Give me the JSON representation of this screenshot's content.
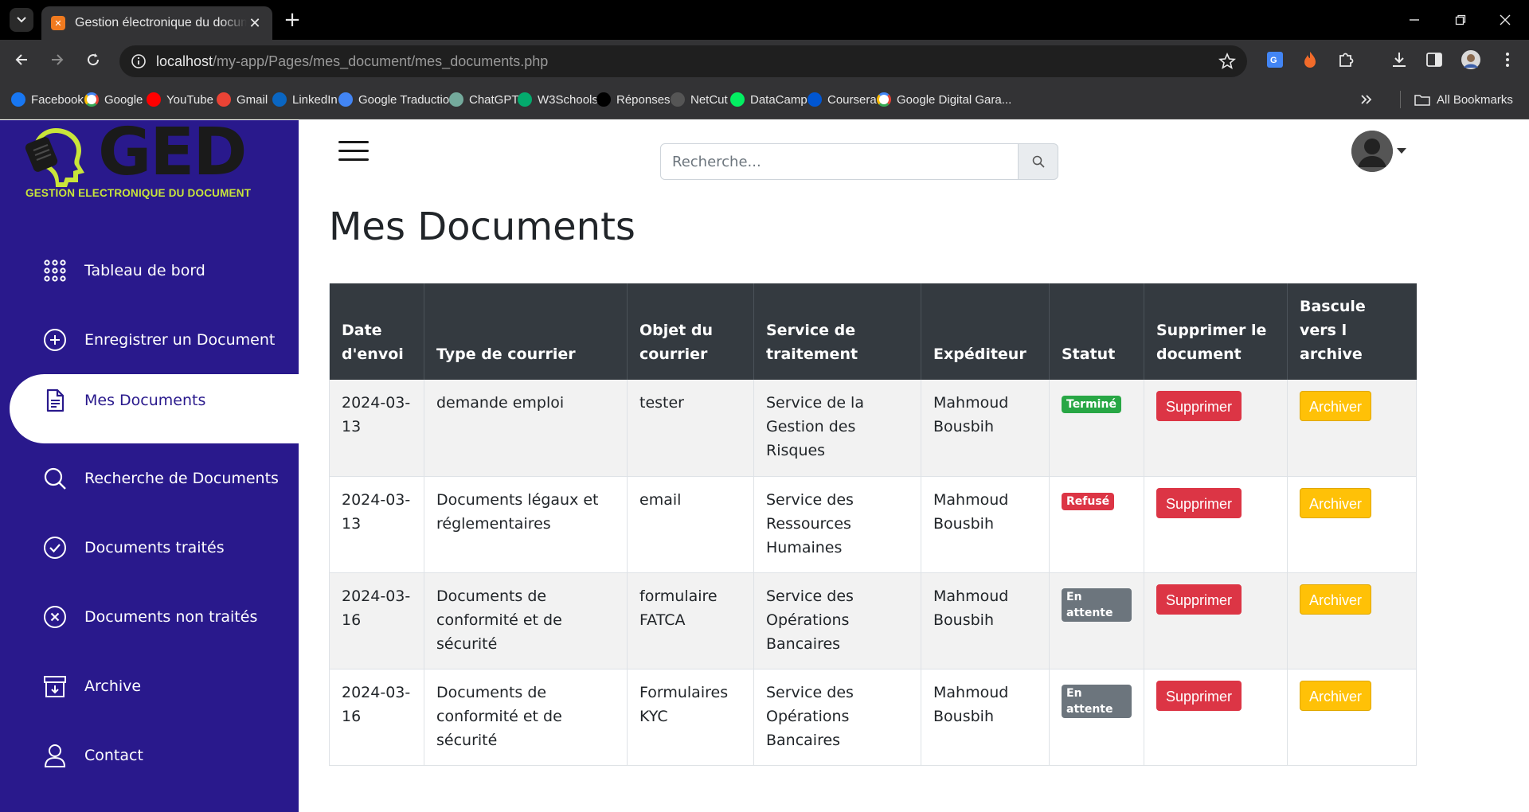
{
  "browser": {
    "tab_title": "Gestion électronique du document",
    "url_host": "localhost",
    "url_path": "/my-app/Pages/mes_document/mes_documents.php",
    "bookmarks": [
      {
        "label": "Facebook",
        "icon": "facebook-icon",
        "color": "#1877f2"
      },
      {
        "label": "Google",
        "icon": "google-icon",
        "color": "#ffffff"
      },
      {
        "label": "YouTube",
        "icon": "youtube-icon",
        "color": "#ff0000"
      },
      {
        "label": "Gmail",
        "icon": "gmail-icon",
        "color": "#ea4335"
      },
      {
        "label": "LinkedIn",
        "icon": "linkedin-icon",
        "color": "#0a66c2"
      },
      {
        "label": "Google Traduction",
        "icon": "google-translate-icon",
        "color": "#4285f4"
      },
      {
        "label": "ChatGPT",
        "icon": "chatgpt-icon",
        "color": "#74aa9c"
      },
      {
        "label": "W3Schools",
        "icon": "w3schools-icon",
        "color": "#04aa6d"
      },
      {
        "label": "Réponses",
        "icon": "x-icon",
        "color": "#000000"
      },
      {
        "label": "NetCut",
        "icon": "netcut-icon",
        "color": "#555555"
      },
      {
        "label": "DataCamp",
        "icon": "datacamp-icon",
        "color": "#03ef62"
      },
      {
        "label": "Coursera",
        "icon": "coursera-icon",
        "color": "#0056d2"
      },
      {
        "label": "Google Digital Gara...",
        "icon": "google-icon",
        "color": "#ffffff"
      }
    ],
    "all_bookmarks_label": "All Bookmarks"
  },
  "sidebar": {
    "logo_text": "GED",
    "logo_subtitle": "GESTION ELECTRONIQUE DU DOCUMENT",
    "items": [
      {
        "label": "Tableau de bord",
        "icon": "grid-dots-icon",
        "active": false
      },
      {
        "label": "Enregistrer un Document",
        "icon": "plus-circle-icon",
        "active": false
      },
      {
        "label": "Mes Documents",
        "icon": "document-icon",
        "active": true
      },
      {
        "label": "Recherche de Documents",
        "icon": "search-icon",
        "active": false
      },
      {
        "label": "Documents traités",
        "icon": "check-circle-icon",
        "active": false
      },
      {
        "label": "Documents non traités",
        "icon": "x-circle-icon",
        "active": false
      },
      {
        "label": "Archive",
        "icon": "archive-icon",
        "active": false
      },
      {
        "label": "Contact",
        "icon": "user-icon",
        "active": false
      }
    ],
    "colors": {
      "background": "#29198c",
      "active_background": "#ffffff"
    }
  },
  "header": {
    "search_placeholder": "Recherche..."
  },
  "page": {
    "title": "Mes Documents"
  },
  "table": {
    "headers": [
      "Date d'envoi",
      "Type de courrier",
      "Objet du courrier",
      "Service de traitement",
      "Expéditeur",
      "Statut",
      "Supprimer le document",
      "Bascule vers l archive"
    ],
    "rows": [
      {
        "date": "2024-03-13",
        "type": "demande emploi",
        "objet": "tester",
        "service": "Service de la Gestion des Risques",
        "expediteur": "Mahmoud Bousbih",
        "statut": "Terminé",
        "statut_color": "#28a745",
        "delete_label": "Supprimer",
        "archive_label": "Archiver"
      },
      {
        "date": "2024-03-13",
        "type": "Documents légaux et réglementaires",
        "objet": "email",
        "service": "Service des Ressources Humaines",
        "expediteur": "Mahmoud Bousbih",
        "statut": "Refusé",
        "statut_color": "#dc3545",
        "delete_label": "Supprimer",
        "archive_label": "Archiver"
      },
      {
        "date": "2024-03-16",
        "type": "Documents de conformité et de sécurité",
        "objet": "formulaire FATCA",
        "service": "Service des Opérations Bancaires",
        "expediteur": "Mahmoud Bousbih",
        "statut": "En attente",
        "statut_color": "#6c757d",
        "delete_label": "Supprimer",
        "archive_label": "Archiver"
      },
      {
        "date": "2024-03-16",
        "type": "Documents de conformité et de sécurité",
        "objet": "Formulaires KYC",
        "service": "Service des Opérations Bancaires",
        "expediteur": "Mahmoud Bousbih",
        "statut": "En attente",
        "statut_color": "#6c757d",
        "delete_label": "Supprimer",
        "archive_label": "Archiver"
      }
    ]
  }
}
